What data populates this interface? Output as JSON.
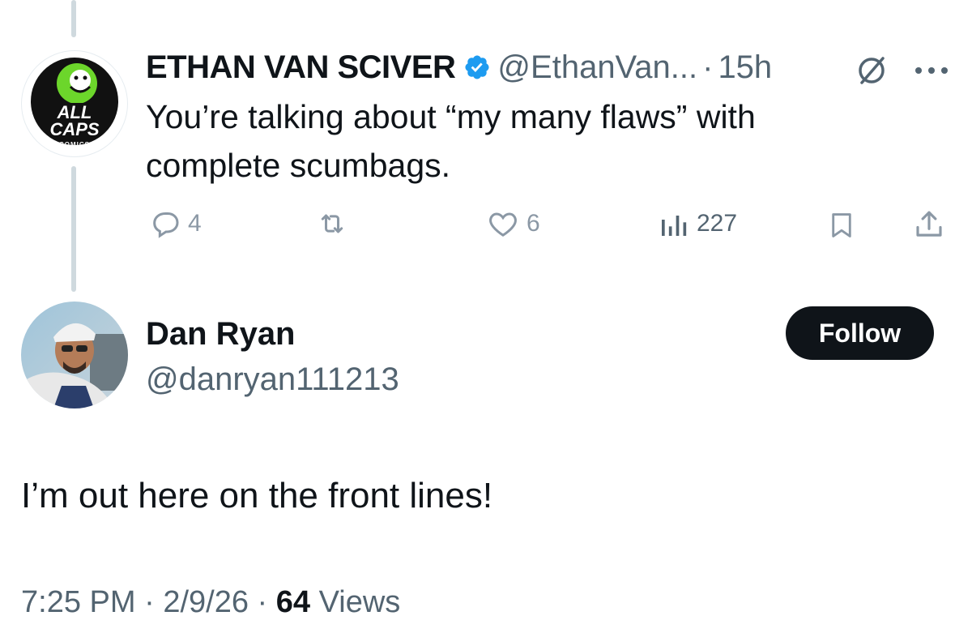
{
  "parent_tweet": {
    "avatar_brand": {
      "line1": "ALL",
      "line2": "CAPS",
      "line3": "COMICS"
    },
    "display_name": "ETHAN VAN SCIVER",
    "handle": "@EthanVan...",
    "separator": "·",
    "time": "15h",
    "text_line1": "You’re talking about “my many flaws” with",
    "text_line2": "complete scumbags.",
    "actions": {
      "replies": "4",
      "reposts": "",
      "likes": "6",
      "views": "227"
    }
  },
  "reply_tweet": {
    "display_name": "Dan Ryan",
    "handle": "@danryan111213",
    "follow_label": "Follow",
    "text": "I’m out here on the front lines!",
    "meta": {
      "time": "7:25 PM",
      "sep1": "·",
      "date": "2/9/26",
      "sep2": "·",
      "views_count": "64",
      "views_label": "Views"
    }
  },
  "colors": {
    "verified": "#1d9bf0",
    "text": "#0f1419",
    "secondary": "#536471",
    "icon": "#8b98a5",
    "brand_green": "#6cd62b"
  }
}
